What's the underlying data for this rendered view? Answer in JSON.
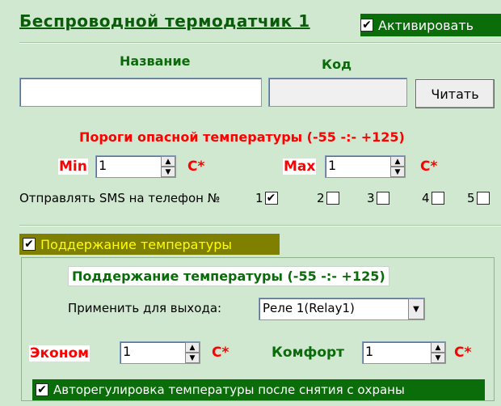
{
  "header": {
    "title": "Беспроводной термодатчик 1",
    "activate_label": "Активировать",
    "activate_checked": true
  },
  "name_field": {
    "label": "Название",
    "value": ""
  },
  "code_field": {
    "label": "Код",
    "value": ""
  },
  "read_button": "Читать",
  "thresholds": {
    "title": "Пороги опасной температуры (-55 -:- +125)",
    "min_label": "Min",
    "min_value": "1",
    "max_label": "Max",
    "max_value": "1",
    "unit": "C*"
  },
  "sms": {
    "label": "Отправлять SMS на телефон №",
    "phones": [
      {
        "num": "1",
        "checked": true
      },
      {
        "num": "2",
        "checked": false
      },
      {
        "num": "3",
        "checked": false
      },
      {
        "num": "4",
        "checked": false
      },
      {
        "num": "5",
        "checked": false
      }
    ]
  },
  "maintain": {
    "checkbox_label": "Поддержание температуры",
    "checked": true,
    "group_title": "Поддержание температуры (-55 -:- +125)",
    "apply_label": "Применить для выхода:",
    "apply_value": "Реле 1(Relay1)",
    "econom_label": "Эконом",
    "econom_value": "1",
    "comfort_label": "Комфорт",
    "comfort_value": "1",
    "unit": "C*",
    "auto_label": "Авторегулировка температуры после снятия с охраны",
    "auto_checked": true
  }
}
